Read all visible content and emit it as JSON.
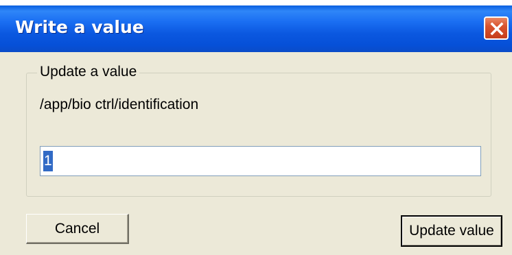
{
  "window": {
    "title": "Write a value"
  },
  "icons": {
    "close": "close-icon"
  },
  "group": {
    "legend": "Update a value",
    "path": "/app/bio ctrl/identification"
  },
  "input": {
    "value": "1",
    "selected": true
  },
  "buttons": {
    "cancel": "Cancel",
    "update": "Update value"
  },
  "colors": {
    "titlebar": "#0b58e0",
    "dialog_bg": "#ece9d8",
    "close_button": "#d9542f",
    "selection": "#316ac5"
  }
}
